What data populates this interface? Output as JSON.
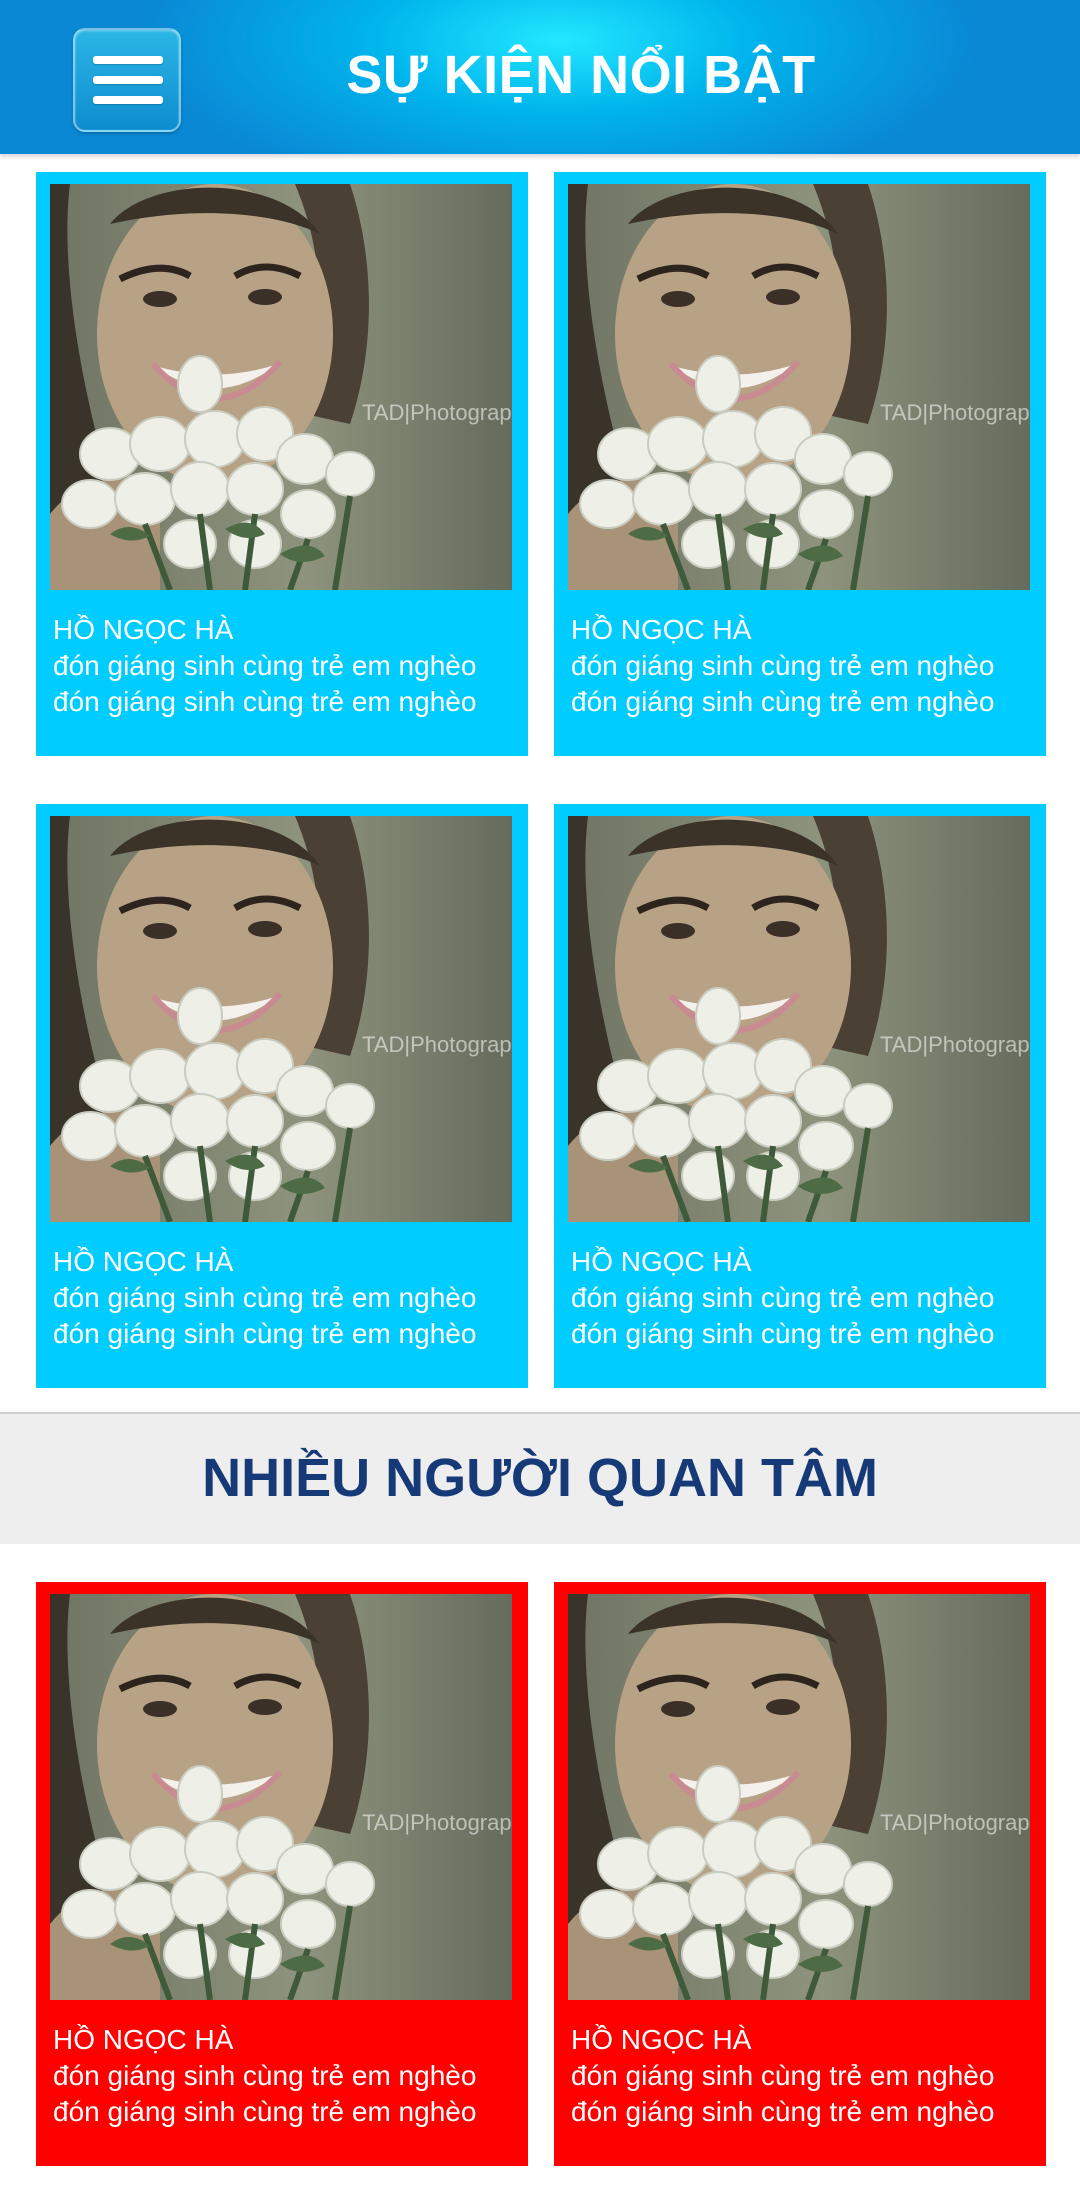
{
  "header": {
    "menu_icon": "hamburger-menu-icon",
    "title": "SỰ KIỆN NỔI BẬT"
  },
  "featured": {
    "items": [
      {
        "name": "HỒ NGỌC HÀ",
        "line1": "đón giáng sinh cùng trẻ em nghèo",
        "line2": "đón giáng sinh cùng trẻ em nghèo",
        "watermark": "TAD|Photograp"
      },
      {
        "name": "HỒ NGỌC HÀ",
        "line1": "đón giáng sinh cùng trẻ em nghèo",
        "line2": "đón giáng sinh cùng trẻ em nghèo",
        "watermark": "TAD|Photograp"
      },
      {
        "name": "HỒ NGỌC HÀ",
        "line1": "đón giáng sinh cùng trẻ em nghèo",
        "line2": "đón giáng sinh cùng trẻ em nghèo",
        "watermark": "TAD|Photograp"
      },
      {
        "name": "HỒ NGỌC HÀ",
        "line1": "đón giáng sinh cùng trẻ em nghèo",
        "line2": "đón giáng sinh cùng trẻ em nghèo",
        "watermark": "TAD|Photograp"
      }
    ]
  },
  "popular": {
    "title": "NHIỀU NGƯỜI QUAN TÂM",
    "items": [
      {
        "name": "HỒ NGỌC HÀ",
        "line1": "đón giáng sinh cùng trẻ em nghèo",
        "line2": "đón giáng sinh cùng trẻ em nghèo",
        "watermark": "TAD|Photograp"
      },
      {
        "name": "HỒ NGỌC HÀ",
        "line1": "đón giáng sinh cùng trẻ em nghèo",
        "line2": "đón giáng sinh cùng trẻ em nghèo",
        "watermark": "TAD|Photograp"
      }
    ]
  },
  "colors": {
    "header_gradient": [
      "#22e8ff",
      "#0a88d4"
    ],
    "featured_card": "#00ccff",
    "popular_card": "#ff0000",
    "section_title": "#163a78",
    "section_bar": "#eeeeee"
  }
}
